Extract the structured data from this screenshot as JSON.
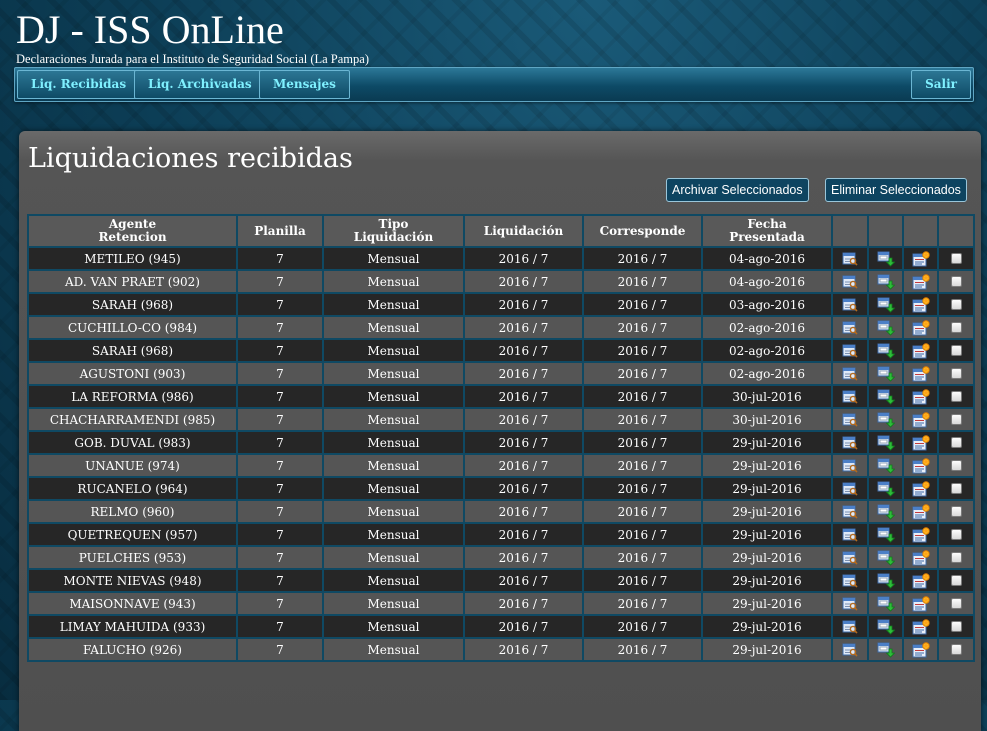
{
  "header": {
    "title": "DJ - ISS OnLine",
    "subtitle": "Declaraciones Jurada para el Instituto de Seguridad Social (La Pampa)"
  },
  "nav": {
    "recibidas": "Liq. Recibidas",
    "archivadas": "Liq. Archivadas",
    "mensajes": "Mensajes",
    "salir": "Salir"
  },
  "page": {
    "title": "Liquidaciones recibidas",
    "archive_button": "Archivar Seleccionados",
    "delete_button": "Eliminar Seleccionados"
  },
  "table": {
    "columns": {
      "agente_1": "Agente",
      "agente_2": "Retencion",
      "planilla": "Planilla",
      "tipo_1": "Tipo",
      "tipo_2": "Liquidación",
      "liquidacion": "Liquidación",
      "corresponde": "Corresponde",
      "fecha_1": "Fecha",
      "fecha_2": "Presentada"
    },
    "rows": [
      {
        "agente": "METILEO (945)",
        "planilla": "7",
        "tipo": "Mensual",
        "liquidacion": "2016 / 7",
        "corresponde": "2016 / 7",
        "fecha": "04-ago-2016"
      },
      {
        "agente": "AD. VAN PRAET (902)",
        "planilla": "7",
        "tipo": "Mensual",
        "liquidacion": "2016 / 7",
        "corresponde": "2016 / 7",
        "fecha": "04-ago-2016"
      },
      {
        "agente": "SARAH (968)",
        "planilla": "7",
        "tipo": "Mensual",
        "liquidacion": "2016 / 7",
        "corresponde": "2016 / 7",
        "fecha": "03-ago-2016"
      },
      {
        "agente": "CUCHILLO-CO (984)",
        "planilla": "7",
        "tipo": "Mensual",
        "liquidacion": "2016 / 7",
        "corresponde": "2016 / 7",
        "fecha": "02-ago-2016"
      },
      {
        "agente": "SARAH (968)",
        "planilla": "7",
        "tipo": "Mensual",
        "liquidacion": "2016 / 7",
        "corresponde": "2016 / 7",
        "fecha": "02-ago-2016"
      },
      {
        "agente": "AGUSTONI (903)",
        "planilla": "7",
        "tipo": "Mensual",
        "liquidacion": "2016 / 7",
        "corresponde": "2016 / 7",
        "fecha": "02-ago-2016"
      },
      {
        "agente": "LA REFORMA (986)",
        "planilla": "7",
        "tipo": "Mensual",
        "liquidacion": "2016 / 7",
        "corresponde": "2016 / 7",
        "fecha": "30-jul-2016"
      },
      {
        "agente": "CHACHARRAMENDI (985)",
        "planilla": "7",
        "tipo": "Mensual",
        "liquidacion": "2016 / 7",
        "corresponde": "2016 / 7",
        "fecha": "30-jul-2016"
      },
      {
        "agente": "GOB. DUVAL (983)",
        "planilla": "7",
        "tipo": "Mensual",
        "liquidacion": "2016 / 7",
        "corresponde": "2016 / 7",
        "fecha": "29-jul-2016"
      },
      {
        "agente": "UNANUE (974)",
        "planilla": "7",
        "tipo": "Mensual",
        "liquidacion": "2016 / 7",
        "corresponde": "2016 / 7",
        "fecha": "29-jul-2016"
      },
      {
        "agente": "RUCANELO (964)",
        "planilla": "7",
        "tipo": "Mensual",
        "liquidacion": "2016 / 7",
        "corresponde": "2016 / 7",
        "fecha": "29-jul-2016"
      },
      {
        "agente": "RELMO (960)",
        "planilla": "7",
        "tipo": "Mensual",
        "liquidacion": "2016 / 7",
        "corresponde": "2016 / 7",
        "fecha": "29-jul-2016"
      },
      {
        "agente": "QUETREQUEN (957)",
        "planilla": "7",
        "tipo": "Mensual",
        "liquidacion": "2016 / 7",
        "corresponde": "2016 / 7",
        "fecha": "29-jul-2016"
      },
      {
        "agente": "PUELCHES (953)",
        "planilla": "7",
        "tipo": "Mensual",
        "liquidacion": "2016 / 7",
        "corresponde": "2016 / 7",
        "fecha": "29-jul-2016"
      },
      {
        "agente": "MONTE NIEVAS (948)",
        "planilla": "7",
        "tipo": "Mensual",
        "liquidacion": "2016 / 7",
        "corresponde": "2016 / 7",
        "fecha": "29-jul-2016"
      },
      {
        "agente": "MAISONNAVE (943)",
        "planilla": "7",
        "tipo": "Mensual",
        "liquidacion": "2016 / 7",
        "corresponde": "2016 / 7",
        "fecha": "29-jul-2016"
      },
      {
        "agente": "LIMAY MAHUIDA (933)",
        "planilla": "7",
        "tipo": "Mensual",
        "liquidacion": "2016 / 7",
        "corresponde": "2016 / 7",
        "fecha": "29-jul-2016"
      },
      {
        "agente": "FALUCHO (926)",
        "planilla": "7",
        "tipo": "Mensual",
        "liquidacion": "2016 / 7",
        "corresponde": "2016 / 7",
        "fecha": "29-jul-2016"
      }
    ],
    "row_icons": [
      "view-report-icon",
      "download-icon",
      "archive-icon",
      "select-checkbox"
    ]
  }
}
